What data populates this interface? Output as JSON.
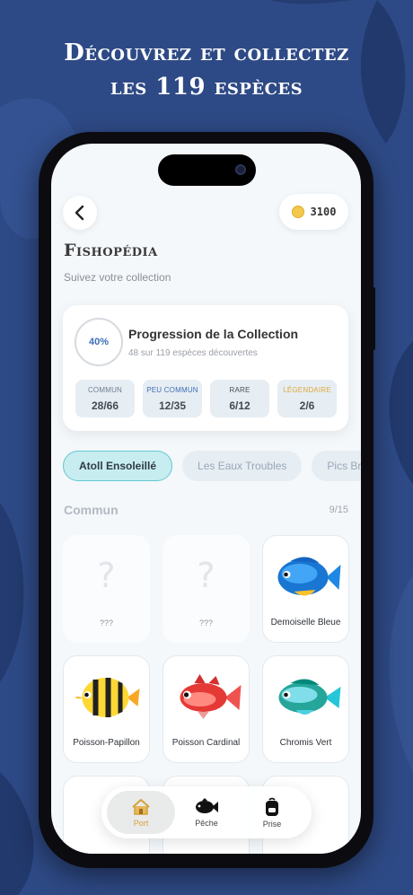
{
  "headline": {
    "line1": "Découvrez et collectez",
    "line2": "les 119 espèces"
  },
  "header": {
    "coins": "3100"
  },
  "page": {
    "title": "Fishopédia",
    "subtitle": "Suivez votre collection"
  },
  "progress": {
    "percent_label": "40%",
    "title": "Progression de la Collection",
    "summary": "48 sur 119 espèces découvertes",
    "rarities": [
      {
        "label": "COMMUN",
        "value": "28/66",
        "color": "#6e7e92"
      },
      {
        "label": "PEU COMMUN",
        "value": "12/35",
        "color": "#3d6fb6"
      },
      {
        "label": "RARE",
        "value": "6/12",
        "color": "#4a4f57"
      },
      {
        "label": "LÉGENDAIRE",
        "value": "2/6",
        "color": "#e0a93b"
      }
    ]
  },
  "tabs": [
    {
      "label": "Atoll Ensoleillé",
      "active": true
    },
    {
      "label": "Les Eaux Troubles",
      "active": false
    },
    {
      "label": "Pics Braisés",
      "active": false
    }
  ],
  "section": {
    "title": "Commun",
    "count": "9/15"
  },
  "fish": [
    {
      "name": "???",
      "locked": true,
      "icon": "question-icon"
    },
    {
      "name": "???",
      "locked": true,
      "icon": "question-icon"
    },
    {
      "name": "Demoiselle Bleue",
      "locked": false,
      "icon": "blue-damselfish-icon"
    },
    {
      "name": "Poisson-Papillon",
      "locked": false,
      "icon": "butterflyfish-icon"
    },
    {
      "name": "Poisson Cardinal",
      "locked": false,
      "icon": "cardinalfish-icon"
    },
    {
      "name": "Chromis Vert",
      "locked": false,
      "icon": "green-chromis-icon"
    }
  ],
  "nav": [
    {
      "label": "Port",
      "icon": "house-icon",
      "active": true
    },
    {
      "label": "Pêche",
      "icon": "fish-icon",
      "active": false
    },
    {
      "label": "Prise",
      "icon": "backpack-icon",
      "active": false
    }
  ],
  "colors": {
    "background": "#2e4a86",
    "accent": "#62c9d0",
    "gold": "#f2c94c"
  }
}
